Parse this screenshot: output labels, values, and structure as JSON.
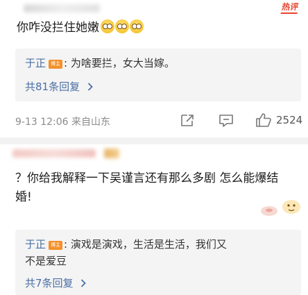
{
  "hot_label": "热评",
  "comments": [
    {
      "text": "你咋没拦住她嫩",
      "emoji_count": 3,
      "reply": {
        "user": "于正",
        "badge": "博主",
        "text": ": 为啥要拦，女大当嫁。"
      },
      "reply_count": "共81条回复",
      "meta": "9-13 12:06  来自山东",
      "likes": "2524"
    },
    {
      "text": "？你给我解释一下吴谨言还有那么多剧 怎么能爆结婚!",
      "reply": {
        "user": "于正",
        "badge": "博主",
        "text_line1": ": 演戏是演戏，生活是生活，我们又",
        "text_line2": "不是爱豆"
      },
      "reply_count": "共7条回复"
    }
  ],
  "icons": [
    "forward-icon",
    "comment-icon",
    "like-icon",
    "chevron-right-icon"
  ],
  "colors": {
    "link": "#4a6fa5",
    "badge": "#f3902b",
    "hot": "#e8442f"
  }
}
